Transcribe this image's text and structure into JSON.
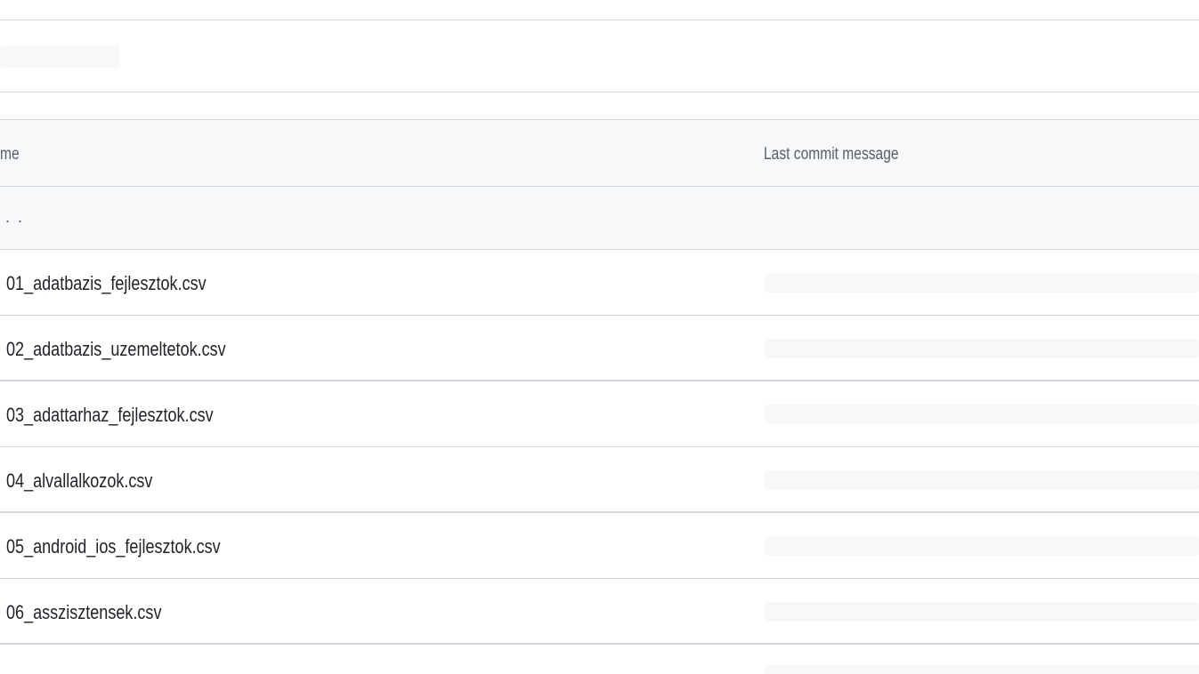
{
  "table": {
    "name_header": "me",
    "message_header": "Last commit message",
    "parent_link": ". .",
    "files": [
      {
        "name": "01_adatbazis_fejlesztok.csv"
      },
      {
        "name": "02_adatbazis_uzemeltetok.csv"
      },
      {
        "name": "03_adattarhaz_fejlesztok.csv"
      },
      {
        "name": "04_alvallalkozok.csv"
      },
      {
        "name": "05_android_ios_fejlesztok.csv"
      },
      {
        "name": "06_asszisztensek.csv"
      }
    ]
  },
  "colors": {
    "border": "#d0d7de",
    "header_bg": "#f6f8fa",
    "text": "#1f2328",
    "muted_text": "#57606a"
  }
}
